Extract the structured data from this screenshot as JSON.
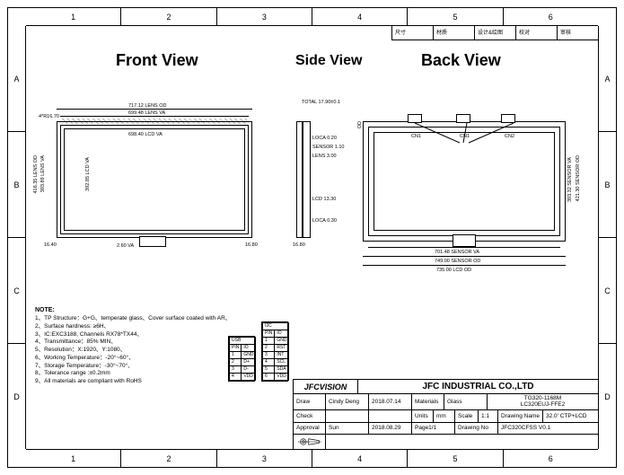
{
  "zones_cols": [
    "1",
    "2",
    "3",
    "4",
    "5",
    "6"
  ],
  "zones_rows": [
    "A",
    "B",
    "C",
    "D"
  ],
  "rev_block": {
    "c1": "尺寸",
    "c2": "材质",
    "c3": "设计&绘图",
    "c4": "校对",
    "c5": "审核"
  },
  "titles": {
    "front": "Front View",
    "side": "Side View",
    "back": "Back View"
  },
  "front": {
    "lens_od": "717.12 LENS OD",
    "lens_va": "699.48 LENS VA",
    "lcd_va": "698.40 LCD VA",
    "lcd_va_v": "392.85 LCD VA",
    "lens_va_v": "393.89 LENS VA",
    "lens_od_v": "416.35 LENS OD",
    "off_l": "16.40",
    "off_r": "16.80",
    "corner": "4*R16.70",
    "small": "2.60 VA"
  },
  "side": {
    "total": "TOTAL 17.90±0.1",
    "loca1": "LOCA 0.20",
    "sensor": "SENSOR 1.10",
    "lens": "LENS 3.00",
    "lcd": "LCD 13.30",
    "loca2": "LOCA 0.30",
    "off": "16.80"
  },
  "back": {
    "cn1": "CN1",
    "cn2": "CN1",
    "cn3": "CN2",
    "sensor_va_v": "393.32 SENSOR VA",
    "sensor_od_v": "421.30 SENSOR OD",
    "sensor_va": "701.48 SENSOR VA",
    "sensor_od": "749.00 SENSOR OD",
    "lcd_od": "735.00 LCD OD",
    "od_v": "OD"
  },
  "notes": {
    "h": "NOTE:",
    "n1": "1、TP Structure：G+G、temperate glass、Cover surface coated with AR、",
    "n2": "2、Surface hardness: ≥6H、",
    "n3": "3、IC:EXC3188, Channels RX78*TX44、",
    "n4": "4、Transmittance：85% MIN、",
    "n5": "5、Resolution：X:1920、Y:1080、",
    "n6": "6、Working Temperature：-20°~60°、",
    "n7": "7、Storage Temperature：-30°~70°、",
    "n8": "8、Tolerance range :±0.2mm",
    "n9": "9、All materials are compliant with RoHS"
  },
  "mini1": [
    [
      "USB"
    ],
    [
      "PIN",
      "IO"
    ],
    [
      "1",
      "GND"
    ],
    [
      "2",
      "D+"
    ],
    [
      "3",
      "D-"
    ],
    [
      "4",
      "VDD"
    ]
  ],
  "mini2": [
    [
      "I2C"
    ],
    [
      "PIN",
      "IO"
    ],
    [
      "1",
      "GND"
    ],
    [
      "2",
      "RST"
    ],
    [
      "3",
      "INT"
    ],
    [
      "4",
      "SCL"
    ],
    [
      "5",
      "SDA"
    ],
    [
      "6",
      "VDD"
    ]
  ],
  "title_block": {
    "logo": "JFCVISION",
    "company": "JFC INDUSTRIAL CO.,LTD",
    "draw_l": "Draw",
    "draw_n": "Cindy Deng",
    "draw_d": "2018.07.14",
    "mat_l": "Materials",
    "mat_v": "Glass",
    "model1": "TG320-1168M",
    "model2": "LC320EUJ-FFE2",
    "check_l": "Check",
    "check_n": "",
    "check_d": "",
    "units_l": "Units",
    "units_v": "mm",
    "scale_l": "Scale",
    "scale_v": "1:1",
    "appr_l": "Approval",
    "appr_n": "Sun",
    "appr_d": "2018.08.29",
    "dwg_l": "Drawing Name",
    "dwg_v": "32.0' CTP+LCD",
    "page": "Page1/1",
    "dwgno_l": "Drawing No",
    "dwgno_v": "JFC320CFSS V0.1"
  }
}
